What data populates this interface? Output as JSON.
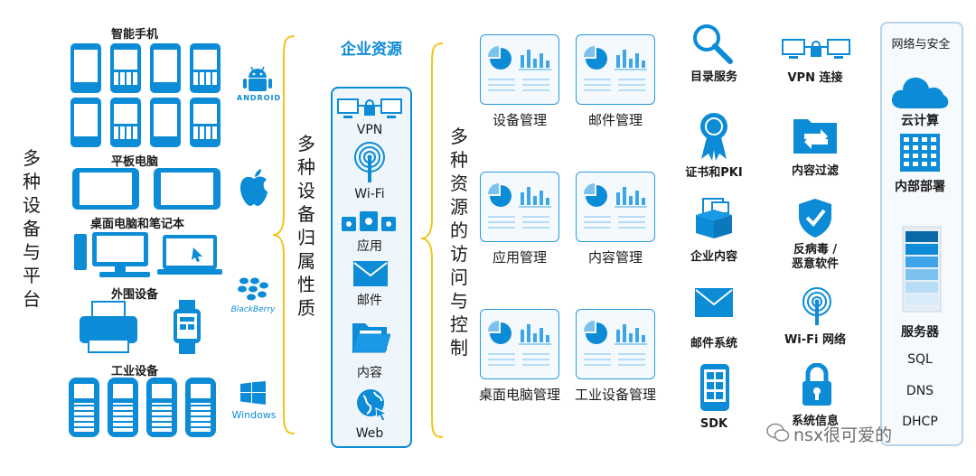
{
  "left_title": "多种设备与平台",
  "devices": {
    "smartphones": "智能手机",
    "tablets": "平板电脑",
    "desktops": "桌面电脑和笔记本",
    "peripherals": "外围设备",
    "industrial": "工业设备"
  },
  "platforms": {
    "android": "ANDROID",
    "blackberry": "BlackBerry",
    "windows": "Windows"
  },
  "ownership_title": "多种设备归属性质",
  "enterprise": {
    "title": "企业资源",
    "items": [
      "VPN",
      "Wi-Fi",
      "应用",
      "邮件",
      "内容",
      "Web"
    ]
  },
  "access_title": "多种资源的访问与控制",
  "management": [
    "设备管理",
    "邮件管理",
    "应用管理",
    "内容管理",
    "桌面电脑管理",
    "工业设备管理"
  ],
  "services_col1": [
    "目录服务",
    "证书和PKI",
    "企业内容",
    "邮件系统",
    "SDK"
  ],
  "services_col2": [
    "VPN 连接",
    "内容过滤",
    "反病毒 /\n恶意软件",
    "Wi-Fi 网络",
    "系统信息"
  ],
  "network": {
    "title": "网络与安全",
    "items": [
      "云计算",
      "内部部署",
      "服务器",
      "SQL",
      "DNS",
      "DHCP"
    ]
  },
  "watermark": "nsx很可爱的",
  "colors": {
    "accent": "#0c8bd6",
    "brace": "#f2c41a"
  }
}
